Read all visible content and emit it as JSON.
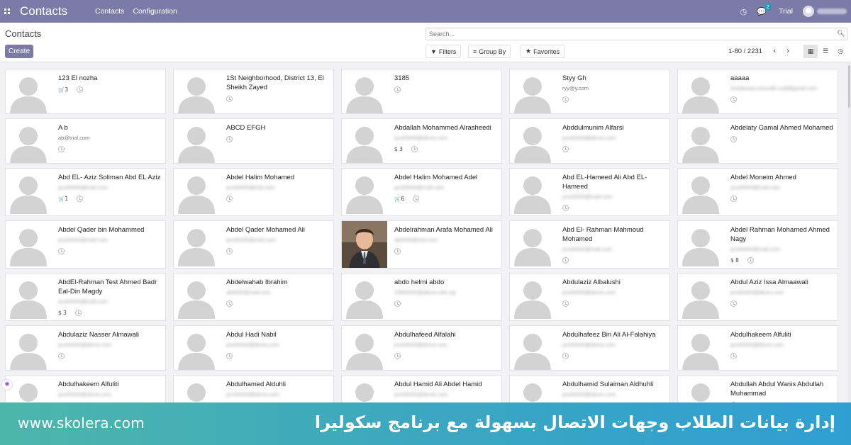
{
  "navbar": {
    "brand": "Contacts",
    "menu": [
      "Contacts",
      "Configuration"
    ],
    "activity_count": "2",
    "company": "Trial",
    "icons": [
      "apps-grid-icon",
      "clock-icon",
      "chat-icon",
      "user-avatar-icon"
    ],
    "colors": {
      "navbar": "#7c7ba7"
    }
  },
  "control": {
    "title": "Contacts",
    "create_label": "Create",
    "search_placeholder": "Search...",
    "filters_label": "Filters",
    "groupby_label": "Group By",
    "favorites_label": "Favorites",
    "pager": "1-80 / 2231",
    "views": [
      "kanban-view-icon",
      "list-view-icon",
      "activity-view-icon"
    ]
  },
  "cards": [
    {
      "name": "123 El nozha",
      "email": "",
      "email_blur": false,
      "tag": "🛒3",
      "photo": false
    },
    {
      "name": "1St Neighborhood, District 13, El Sheikh Zayed",
      "email": "",
      "email_blur": false,
      "tag": "",
      "photo": false
    },
    {
      "name": "3185",
      "email": "",
      "email_blur": false,
      "tag": "",
      "photo": false
    },
    {
      "name": "Styy Gh",
      "email": "ryy@y.com",
      "email_blur": false,
      "tag": "",
      "photo": false
    },
    {
      "name": "aaaaa",
      "email": "testaleeaa.nsnnsdk.csdt@gmail.com",
      "email_blur": true,
      "tag": "",
      "photo": false
    },
    {
      "name": "A b",
      "email": "ab@trial.com",
      "email_blur": false,
      "tag": "",
      "photo": false
    },
    {
      "name": "ABCD EFGH",
      "email": "",
      "email_blur": false,
      "tag": "",
      "photo": false
    },
    {
      "name": "Abdallah Mohammed Alrasheedi",
      "email": "pcs00000@demo.com",
      "email_blur": true,
      "tag": "$ 3",
      "photo": false
    },
    {
      "name": "Abddulmunim Alfarsi",
      "email": "pcs00000@demo.com",
      "email_blur": true,
      "tag": "",
      "photo": false
    },
    {
      "name": "Abdelaty Gamal Ahmed Mohamed",
      "email": "",
      "email_blur": false,
      "tag": "",
      "photo": false
    },
    {
      "name": "Abd EL- Aziz Soliman Abd EL Aziz",
      "email": "pcs00000@mail.com",
      "email_blur": true,
      "tag": "🛒1",
      "photo": false
    },
    {
      "name": "Abdel Halim Mohamed",
      "email": "pcs00000@trial.com",
      "email_blur": true,
      "tag": "",
      "photo": false
    },
    {
      "name": "Abdel Halim Mohamed Adel",
      "email": "pcs00000@mail.com",
      "email_blur": true,
      "tag": "🛒6",
      "photo": false
    },
    {
      "name": "Abd EL-Hameed Ali Abd EL-Hameed",
      "email": "pcs00000@mail.com",
      "email_blur": true,
      "tag": "",
      "photo": false
    },
    {
      "name": "Abdel Moneim Ahmed",
      "email": "pcs00000@mail.com",
      "email_blur": true,
      "tag": "",
      "photo": false
    },
    {
      "name": "Abdel Qader bin Mohammed",
      "email": "pcs00000@mail.com",
      "email_blur": true,
      "tag": "",
      "photo": false
    },
    {
      "name": "Abdel Qader Mohamed Ali",
      "email": "pcs00000@mail.com",
      "email_blur": true,
      "tag": "",
      "photo": false
    },
    {
      "name": "Abdelrahman Arafa Mohamed Ali",
      "email": "ab0000@trial.com",
      "email_blur": true,
      "tag": "",
      "photo": true
    },
    {
      "name": "Abd El- Rahman Mahmoud Mohamed",
      "email": "pcs00000@mail.com",
      "email_blur": true,
      "tag": "",
      "photo": false
    },
    {
      "name": "Abdel Rahman Mohamed Ahmed Nagy",
      "email": "pcs00000@mail.com",
      "email_blur": true,
      "tag": "$ 8",
      "photo": false
    },
    {
      "name": "AbdEl-Rahman Test Ahmed Badr Eal-Din Magdy",
      "email": "pcs00000@mail.com",
      "email_blur": true,
      "tag": "$ 3",
      "photo": false
    },
    {
      "name": "Abdelwahab Ibrahim",
      "email": "ab0000@mail.com",
      "email_blur": true,
      "tag": "",
      "photo": false
    },
    {
      "name": "abdo helmi abdo",
      "email": "10000000@aboss.edu.eg",
      "email_blur": true,
      "tag": "",
      "photo": false
    },
    {
      "name": "Abdulaziz Albalushi",
      "email": "pcs00000@demo.com",
      "email_blur": true,
      "tag": "",
      "photo": false
    },
    {
      "name": "Abdul Aziz Issa Almaawali",
      "email": "pcs00000@demo.com",
      "email_blur": true,
      "tag": "",
      "photo": false
    },
    {
      "name": "Abdulaziz Nasser Almawali",
      "email": "pcs00000@demo.com",
      "email_blur": true,
      "tag": "",
      "photo": false
    },
    {
      "name": "Abdul Hadi Nabil",
      "email": "pcs00000@demo.com",
      "email_blur": true,
      "tag": "",
      "photo": false
    },
    {
      "name": "Abdulhafeed Alfalahi",
      "email": "pcs00000@demo.com",
      "email_blur": true,
      "tag": "",
      "photo": false
    },
    {
      "name": "Abdulhafeez Bin Ali Al-Falahiya",
      "email": "pcs00000@demo.com",
      "email_blur": true,
      "tag": "",
      "photo": false
    },
    {
      "name": "Abdulhakeem Alfuliti",
      "email": "pcs00000@demo.com",
      "email_blur": true,
      "tag": "",
      "photo": false
    },
    {
      "name": "Abdulhakeem Alfuliti",
      "email": "pcs00000@demo.com",
      "email_blur": true,
      "tag": "",
      "photo": false
    },
    {
      "name": "Abdulhamed Alduhli",
      "email": "pcs00000@demo.com",
      "email_blur": true,
      "tag": "",
      "photo": false
    },
    {
      "name": "Abdul Hamid Ali Abdel Hamid",
      "email": "pcs00000@demo.com",
      "email_blur": true,
      "tag": "",
      "photo": false
    },
    {
      "name": "Abdulhamid Sulaiman Aldhuhli",
      "email": "pcs00000@demo.com",
      "email_blur": true,
      "tag": "",
      "photo": false
    },
    {
      "name": "Abdullah Abdul Wanis Abdullah Muhammad",
      "email": "",
      "email_blur": false,
      "tag": "",
      "photo": false
    }
  ],
  "banner": {
    "site": "www.skolera.com",
    "slogan": "إدارة بيانات الطلاب وجهات الاتصال بسهولة مع برنامج سكوليرا"
  }
}
